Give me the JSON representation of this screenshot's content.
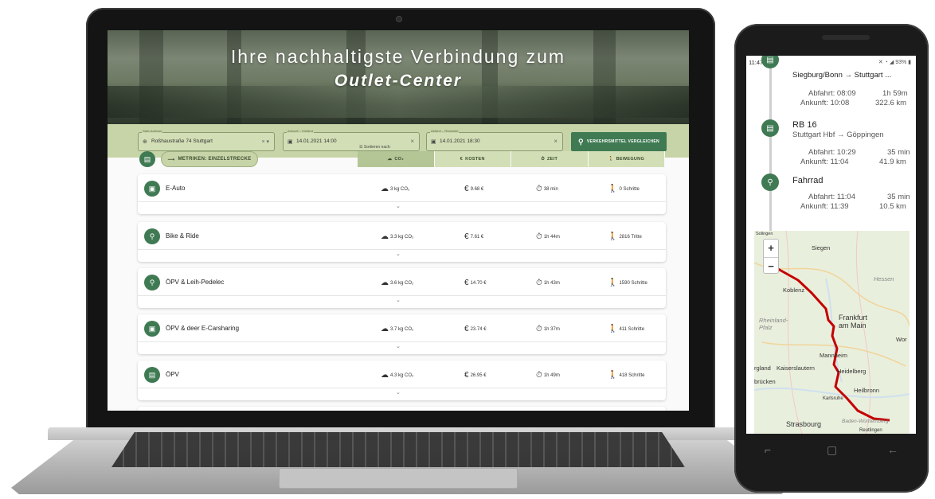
{
  "laptop": {
    "hero": {
      "title": "Ihre nachhaltigste Verbindung zum",
      "subtitle": "Outlet-Center"
    },
    "search": {
      "start": {
        "label": "Start-Adresse",
        "value": "Roßhaustraße 74 Stuttgart"
      },
      "arrival": {
        "label": "Ankunft – Hinfahrt",
        "value": "14.01.2021 14:00"
      },
      "departure": {
        "label": "Abfahrt – Rückfahrt",
        "value": "14.01.2021 18:30"
      },
      "compare_label": "VERKEHRSMITTEL VERGLEICHEN"
    },
    "toolbar": {
      "metric_label": "METRIKEN: EINZELSTRECKE",
      "sort_label": "Sortieren nach:",
      "sort_tabs": [
        "CO₂",
        "KOSTEN",
        "ZEIT",
        "BEWEGUNG"
      ]
    },
    "routes": [
      {
        "name": "E-Auto",
        "co2": "3 kg CO₂",
        "cost": "9.68 €",
        "time": "38 min",
        "movement": "0 Schritte",
        "icon": "car-icon"
      },
      {
        "name": "Bike & Ride",
        "co2": "3.3 kg CO₂",
        "cost": "7.61 €",
        "time": "1h 44m",
        "movement": "2816 Tritte",
        "icon": "bike-icon"
      },
      {
        "name": "ÖPV & Leih-Pedelec",
        "co2": "3.6 kg CO₂",
        "cost": "14.70 €",
        "time": "1h 43m",
        "movement": "1590 Schritte",
        "icon": "pedelec-icon"
      },
      {
        "name": "ÖPV & deer E-Carsharing",
        "co2": "3.7 kg CO₂",
        "cost": "23.74 €",
        "time": "1h 37m",
        "movement": "411 Schritte",
        "icon": "car-icon"
      },
      {
        "name": "ÖPV",
        "co2": "4.3 kg CO₂",
        "cost": "26.95 €",
        "time": "1h 49m",
        "movement": "418 Schritte",
        "icon": "train-icon"
      }
    ]
  },
  "phone": {
    "status": {
      "time": "11:47",
      "right": "93%"
    },
    "legs": [
      {
        "title": "",
        "route": "Siegburg/Bonn → Stuttgart ...",
        "dep": "Abfahrt: 08:09",
        "dur": "1h 59m",
        "arr": "Ankunft: 10:08",
        "dist": "322.6 km",
        "icon": "train-icon"
      },
      {
        "title": "RB 16",
        "route": "Stuttgart Hbf → Göppingen",
        "dep": "Abfahrt: 10:29",
        "dur": "35 min",
        "arr": "Ankunft: 11:04",
        "dist": "41.9 km",
        "icon": "train-icon"
      },
      {
        "title": "Fahrrad",
        "route": "",
        "dep": "Abfahrt: 11:04",
        "dur": "35 min",
        "arr": "Ankunft: 11:39",
        "dist": "10.5 km",
        "icon": "bike-icon"
      }
    ],
    "map": {
      "labels": [
        "Siegen",
        "Koblenz",
        "Hessen",
        "Rheinland-Pfalz",
        "Frankfurt am Main",
        "Mannheim",
        "Kaiserslautern",
        "Heidelberg",
        "Heilbronn",
        "Karlsruhe",
        "Strasbourg",
        "Baden-Württemberg",
        "Reutlingen",
        "Wor",
        "brücken",
        "rgland",
        "Solingen"
      ],
      "zoom_in": "+",
      "zoom_out": "−"
    }
  },
  "colors": {
    "accent": "#3f7a53",
    "bar": "#c6d4a8",
    "route": "#c40000"
  }
}
